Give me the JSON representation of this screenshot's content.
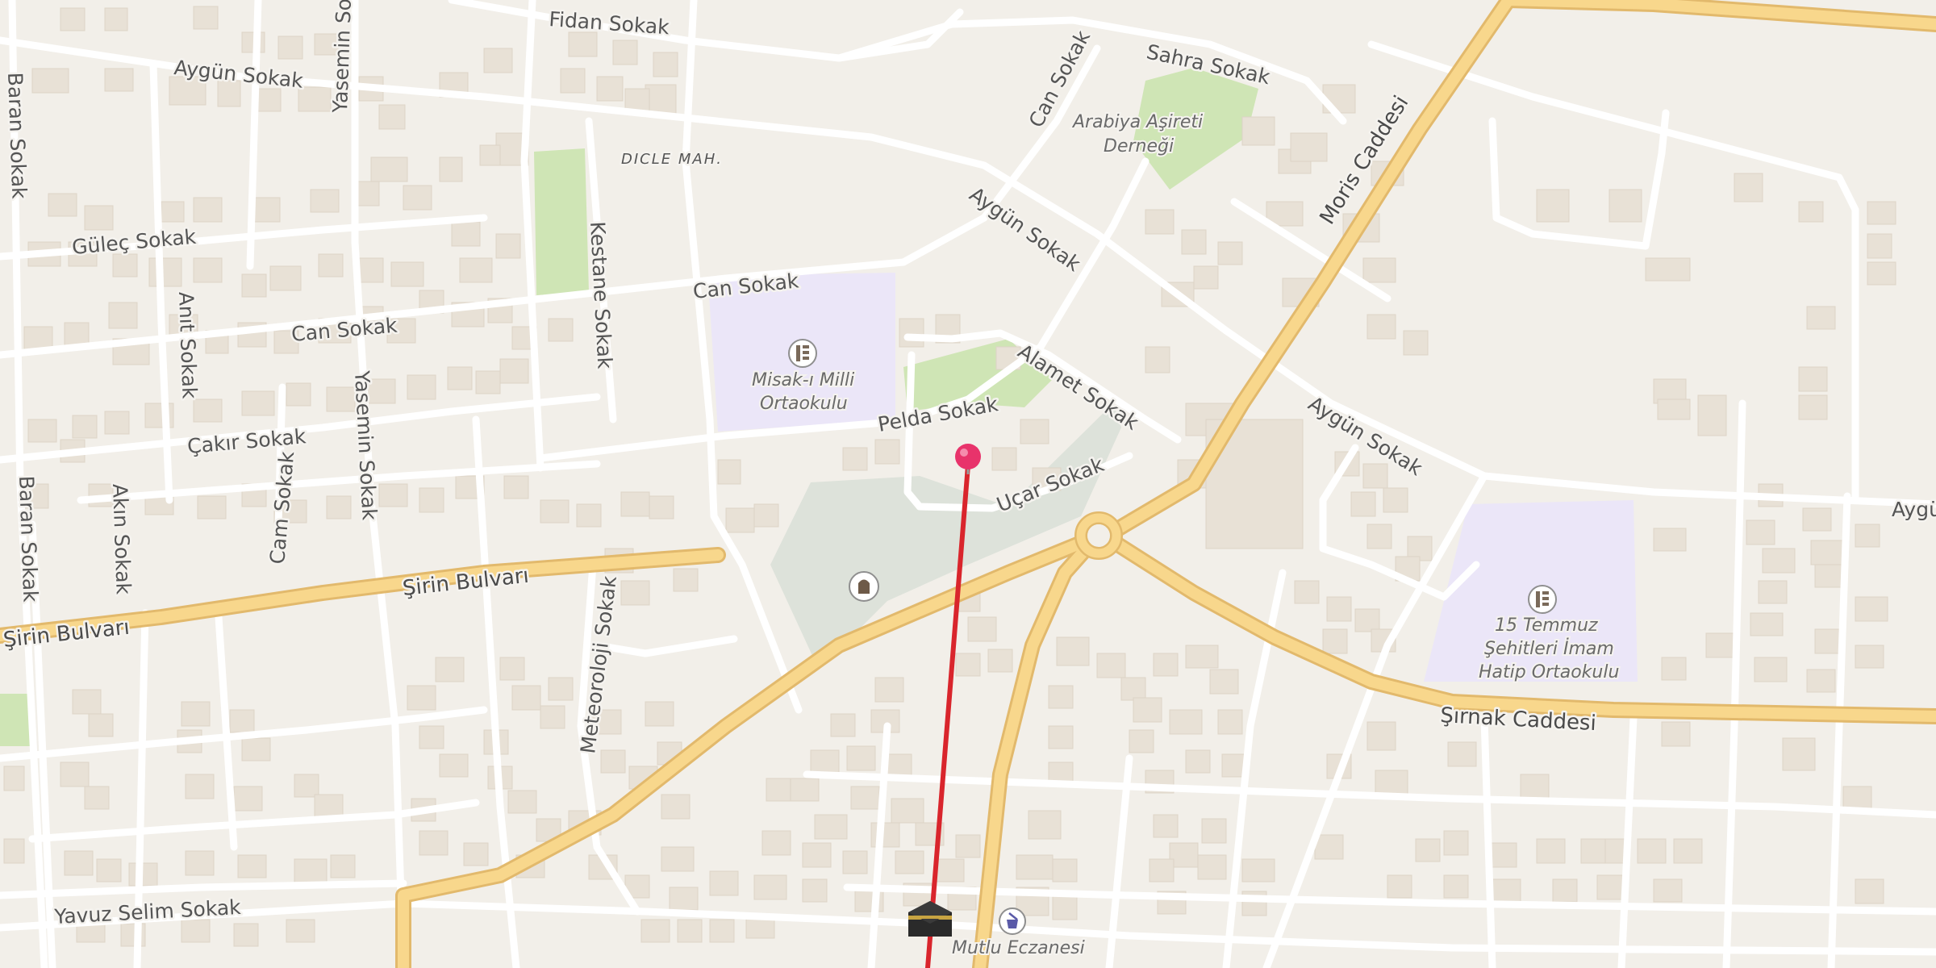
{
  "map": {
    "area_label": "DICLE MAH.",
    "streets": {
      "fidan": "Fidan Sokak",
      "sahra": "Sahra Sokak",
      "aygun1": "Aygün Sokak",
      "aygun2": "Aygün Sokak",
      "aygun3": "Aygün Sokak",
      "aygun4": "Aygü",
      "yasemin1": "Yasemin Sok",
      "yasemin2": "Yasemin Sokak",
      "baran1": "Baran Sokak",
      "baran2": "Baran Sokak",
      "guler": "Güleç Sokak",
      "can1": "Can Sokak",
      "can2": "Can Sokak",
      "can3": "Can Sokak",
      "anit": "Anıt Sokak",
      "kestane": "Kestane Sokak",
      "cakir": "Çakır Sokak",
      "akin": "Akın Sokak",
      "cam": "Cam Sokak",
      "pelda": "Pelda Sokak",
      "alamet": "Alamet Sokak",
      "ucar": "Uçar Sokak",
      "moris": "Moris Caddesi",
      "sirin1": "Şirin Bulvarı",
      "sirin2": "Şirin Bulvarı",
      "meteoroloji": "Meteoroloji Sokak",
      "sirnak": "Şırnak Caddesi",
      "yavuz": "Yavuz Selim Sokak"
    },
    "pois": {
      "arabiya_l1": "Arabiya Aşireti",
      "arabiya_l2": "Derneği",
      "misak_l1": "Misak-ı Milli",
      "misak_l2": "Ortaokulu",
      "temmuz_l1": "15 Temmuz",
      "temmuz_l2": "Şehitleri İmam",
      "temmuz_l3": "Hatip Ortaokulu",
      "eczane": "Mutlu Eczanesi"
    },
    "icons": [
      "map-pin-icon",
      "school-icon",
      "cemetery-icon",
      "kaaba-mosque-icon",
      "pharmacy-icon"
    ],
    "colors": {
      "background": "#f2efe9",
      "road_major": "#f8d78c",
      "road_minor": "#ffffff",
      "building": "#e8e1d6",
      "park": "#cfe5b5",
      "school": "#ebe6f8",
      "cemetery": "#dde2da",
      "route_line": "#d9252c",
      "pin": "#e8336b"
    }
  }
}
